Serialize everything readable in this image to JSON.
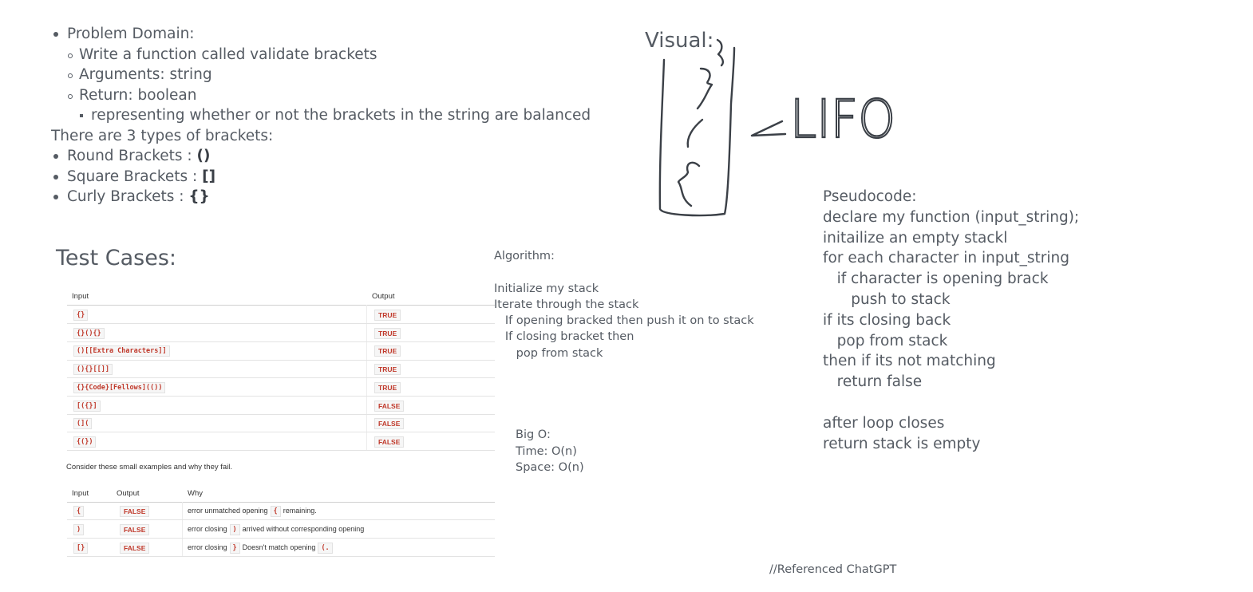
{
  "problem_domain": {
    "heading": "Problem Domain:",
    "items": [
      "Write a function called validate brackets",
      "Arguments: string",
      "Return: boolean"
    ],
    "sub_item": "representing whether or not the brackets in the string are balanced",
    "types_intro": "There are 3 types of brackets:",
    "types": [
      {
        "label": "Round Brackets : ",
        "symbol": "()"
      },
      {
        "label": "Square Brackets : ",
        "symbol": "[]"
      },
      {
        "label": "Curly Brackets : ",
        "symbol": "{}"
      }
    ]
  },
  "test_cases": {
    "title": "Test Cases:",
    "table1": {
      "headers": [
        "Input",
        "Output"
      ],
      "rows": [
        {
          "input": "{}",
          "output": "TRUE"
        },
        {
          "input": "{}(){}",
          "output": "TRUE"
        },
        {
          "input": "()[[Extra Characters]]",
          "output": "TRUE"
        },
        {
          "input": "(){}[[]]",
          "output": "TRUE"
        },
        {
          "input": "{}{Code}[Fellows](())",
          "output": "TRUE"
        },
        {
          "input": "[({}]",
          "output": "FALSE"
        },
        {
          "input": "(](",
          "output": "FALSE"
        },
        {
          "input": "{(})",
          "output": "FALSE"
        }
      ]
    },
    "note": "Consider these small examples and why they fail.",
    "table2": {
      "headers": [
        "Input",
        "Output",
        "Why"
      ],
      "rows": [
        {
          "input": "{",
          "output": "FALSE",
          "why_a": "error unmatched opening",
          "why_code": "{",
          "why_b": "remaining."
        },
        {
          "input": ")",
          "output": "FALSE",
          "why_a": "error closing",
          "why_code": ")",
          "why_b": "arrived without corresponding opening"
        },
        {
          "input": "[}",
          "output": "FALSE",
          "why_a": "error closing",
          "why_code": "}",
          "why_b": "Doesn't match opening",
          "why_code2": "(."
        }
      ]
    }
  },
  "algorithm": {
    "text": "Algorithm:\n\nInitialize my stack\nIterate through the stack\n   If opening bracked then push it on to stack\n   If closing bracket then\n      pop from stack"
  },
  "big_o": {
    "text": "Big O:\nTime: O(n)\nSpace: O(n)"
  },
  "visual": {
    "label": "Visual:",
    "annotation": "LIFO"
  },
  "pseudocode": {
    "text": "Pseudocode:\ndeclare my function (input_string);\ninitailize an empty stackl\nfor each character in input_string\n   if character is opening brack\n      push to stack\nif its closing back\n   pop from stack\nthen if its not matching\n   return false\n\nafter loop closes\nreturn stack is empty"
  },
  "reference": "//Referenced ChatGPT",
  "colors": {
    "text": "#555b63",
    "code_red": "#c0392b"
  }
}
